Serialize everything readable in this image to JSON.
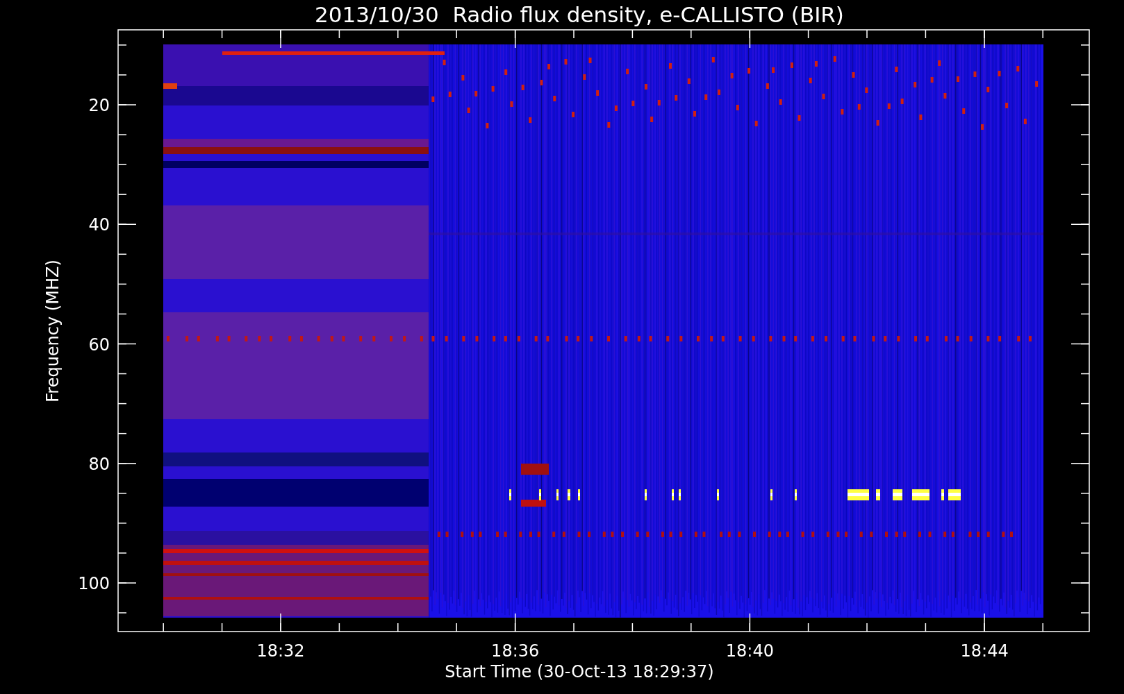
{
  "title": "2013/10/30  Radio flux density, e-CALLISTO (BIR)",
  "ylabel": "Frequency (MHZ)",
  "xlabel": "Start Time (30-Oct-13 18:29:37)",
  "yticks": [
    "20",
    "40",
    "60",
    "80",
    "100"
  ],
  "xticks": [
    "18:32",
    "18:36",
    "18:40",
    "18:44"
  ]
}
